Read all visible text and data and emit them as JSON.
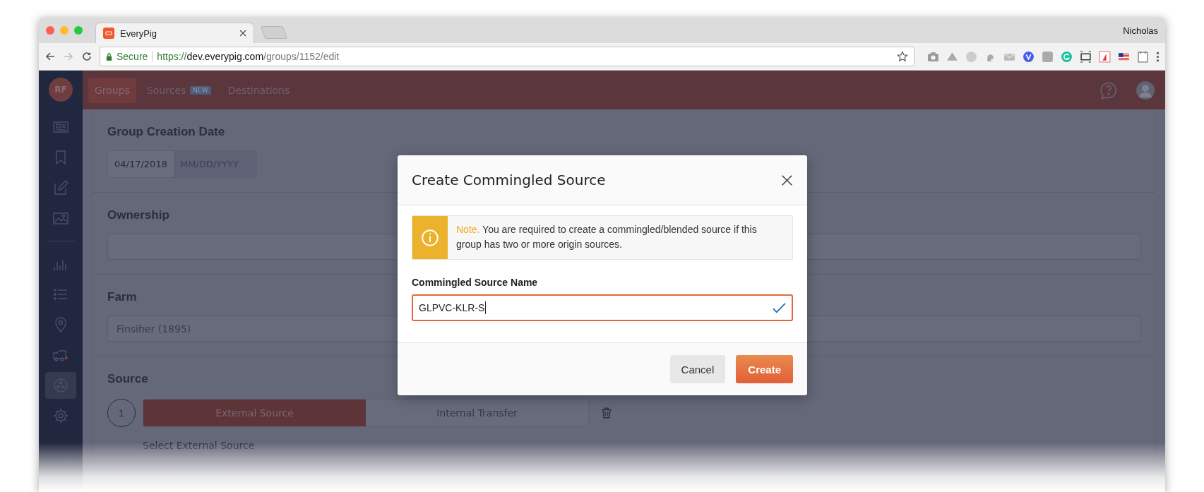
{
  "browser": {
    "tab_title": "EveryPig",
    "profile": "Nicholas",
    "secure_label": "Secure",
    "url_scheme": "https://",
    "url_host": "dev.everypig.com",
    "url_path": "/groups/1152/edit"
  },
  "app": {
    "avatar_initials": "RF",
    "nav": [
      {
        "label": "Groups",
        "selected": true
      },
      {
        "label": "Sources",
        "badge": "NEW",
        "selected": false
      },
      {
        "label": "Destinations",
        "selected": false
      }
    ],
    "sidebar": {
      "items": [
        {
          "selected": false
        },
        {
          "selected": false
        },
        {
          "selected": false
        },
        {
          "selected": false
        },
        {
          "selected": false
        },
        {
          "selected": false
        },
        {
          "selected": false
        },
        {
          "selected": false
        },
        {
          "selected": true
        },
        {
          "selected": false
        }
      ]
    }
  },
  "form": {
    "date_label": "Group Creation Date",
    "date_value": "04/17/2018",
    "date_placeholder": "MM/DD/YYYY",
    "ownership_label": "Ownership",
    "farm_label": "Farm",
    "farm_value": "Finsiher (1895)",
    "source_label": "Source",
    "source_step": "1",
    "source_tabs": [
      {
        "label": "External Source",
        "selected": true
      },
      {
        "label": "Internal Transfer",
        "selected": false
      }
    ],
    "select_label": "Select External Source"
  },
  "modal": {
    "title": "Create Commingled Source",
    "note_lead": "Note.",
    "note_text": " You are required to create a commingled/blended source if this group has two or more origin sources.",
    "field_label": "Commingled Source Name",
    "field_value": "GLPVC-KLR-S",
    "valid": true,
    "buttons": [
      {
        "label": "Cancel",
        "kind": "secondary"
      },
      {
        "label": "Create",
        "kind": "primary"
      }
    ]
  }
}
